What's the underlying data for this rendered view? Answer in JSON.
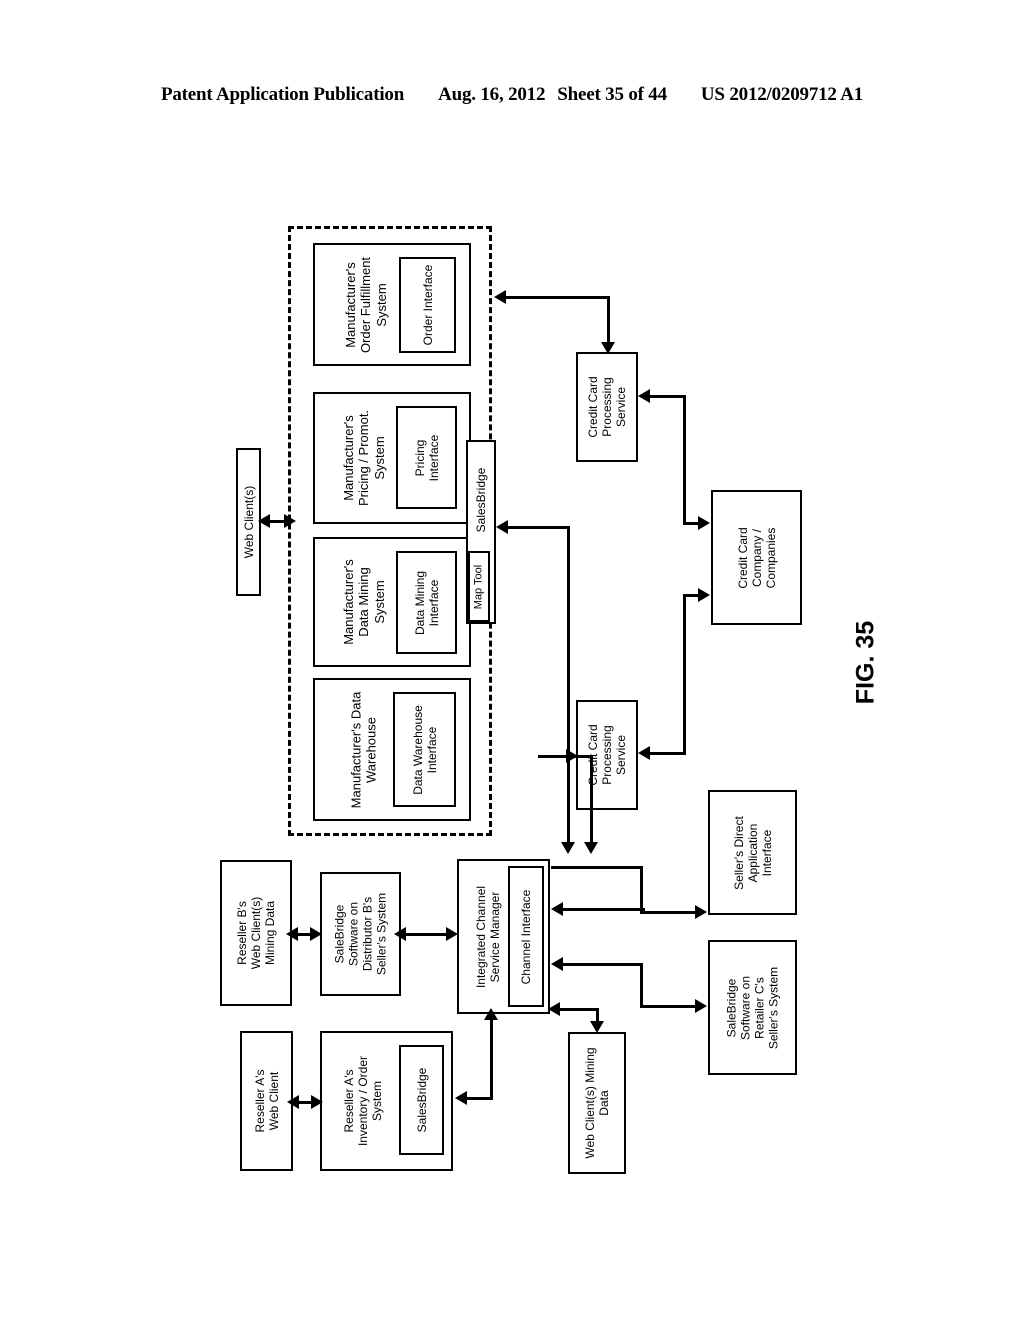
{
  "header": {
    "publication": "Patent Application Publication",
    "date": "Aug. 16, 2012",
    "sheet": "Sheet 35 of 44",
    "docnum": "US 2012/0209712 A1"
  },
  "figure": {
    "label": "FIG. 35"
  },
  "boxes": {
    "web_clients": "Web Client(s)",
    "order_fulfillment": "Manufacturer's\nOrder Fulfillment\nSystem",
    "order_interface": "Order Interface",
    "pricing_system": "Manufacturer's\nPricing / Promot.\nSystem",
    "pricing_interface": "Pricing\nInterface",
    "data_mining_system": "Manufacturer's\nData Mining\nSystem",
    "data_mining_interface": "Data Mining\nInterface",
    "data_warehouse": "Manufacturer's Data\nWarehouse",
    "data_warehouse_interface": "Data Warehouse\nInterface",
    "salesbridge_bar": "SalesBridge",
    "map_tool": "Map Tool",
    "ccps_top": "Credit Card\nProcessing\nService",
    "ccps_bottom": "Credit Card\nProcessing\nService",
    "cc_company": "Credit Card\nCompany /\nCompanies",
    "sellers_direct": "Seller's Direct\nApplication\nInterface",
    "salebridge_retailer_c": "SaleBridge\nSoftware on\nRetailer C's\nSeller's System",
    "reseller_b_web_clients": "Reseller B's\nWeb Client(s)\nMining Data",
    "salebridge_distributor_b": "SaleBridge\nSoftware on\nDistributor B's\nSeller's System",
    "icsm": "Integrated Channel\nService Manager",
    "channel_interface": "Channel Interface",
    "web_clients_mining": "Web Client(s) Mining\nData",
    "reseller_a_web_client": "Reseller A's\nWeb Client",
    "reseller_a_inventory": "Reseller A's\nInventory / Order\nSystem",
    "reseller_a_salesbridge": "SalesBridge"
  }
}
